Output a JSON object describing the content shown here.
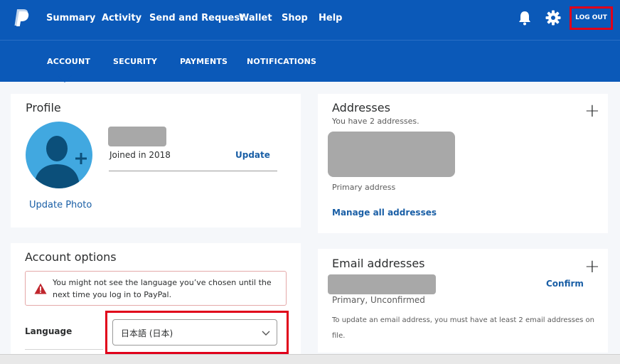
{
  "nav": {
    "items": [
      "Summary",
      "Activity",
      "Send and Request",
      "Wallet",
      "Shop",
      "Help"
    ],
    "logout_label": "LOG OUT"
  },
  "subnav": {
    "items": [
      "ACCOUNT",
      "SECURITY",
      "PAYMENTS",
      "NOTIFICATIONS"
    ],
    "active": "ACCOUNT"
  },
  "profile": {
    "title": "Profile",
    "joined": "Joined in 2018",
    "update_label": "Update",
    "update_photo_label": "Update Photo"
  },
  "addresses": {
    "title": "Addresses",
    "count_text": "You have 2 addresses.",
    "primary_label": "Primary address",
    "manage_label": "Manage all addresses",
    "add_symbol": "+"
  },
  "account_options": {
    "title": "Account options",
    "alert_text": "You might not see the language you’ve chosen until the next time you log in to PayPal.",
    "language_label": "Language",
    "language_value": "日本語 (日本)"
  },
  "emails": {
    "title": "Email addresses",
    "status": "Primary, Unconfirmed",
    "confirm_label": "Confirm",
    "info_line1": "To update an email address, you must have at least 2 email addresses on",
    "info_line2": "file.",
    "add_symbol": "+"
  },
  "colors": {
    "brand_blue": "#0b59b8",
    "link_blue": "#1a5fa6",
    "avatar_blue": "#41a8e0",
    "highlight_red": "#e0001a",
    "alert_red": "#c0262d"
  },
  "icons": {
    "logo": "paypal-logo-icon",
    "bell": "bell-icon",
    "settings": "gear-icon",
    "avatar": "person-avatar-icon",
    "alert": "warning-triangle-icon",
    "chevron": "chevron-down-icon"
  }
}
